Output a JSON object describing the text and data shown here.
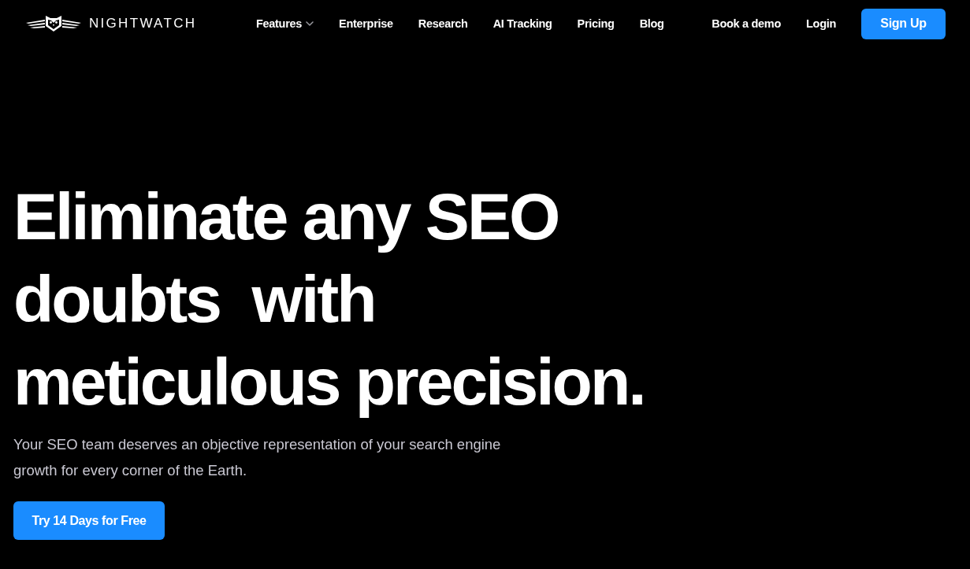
{
  "header": {
    "logo_text": "NIGHTWATCH",
    "nav": [
      {
        "label": "Features",
        "kind": "dropdown"
      },
      {
        "label": "Enterprise",
        "kind": "link"
      },
      {
        "label": "Research",
        "kind": "link"
      },
      {
        "label": "AI Tracking",
        "kind": "link"
      },
      {
        "label": "Pricing",
        "kind": "link"
      },
      {
        "label": "Blog",
        "kind": "link"
      }
    ],
    "actions": [
      {
        "label": "Book a demo",
        "kind": "link"
      },
      {
        "label": "Login",
        "kind": "link"
      },
      {
        "label": "Sign Up",
        "kind": "primary"
      }
    ]
  },
  "hero": {
    "heading": "Eliminate any SEO doubts  with meticulous precision.",
    "description": "Your SEO team deserves an objective representation of your search engine growth for every corner of the Earth.",
    "cta": "Try 14 Days for Free"
  }
}
